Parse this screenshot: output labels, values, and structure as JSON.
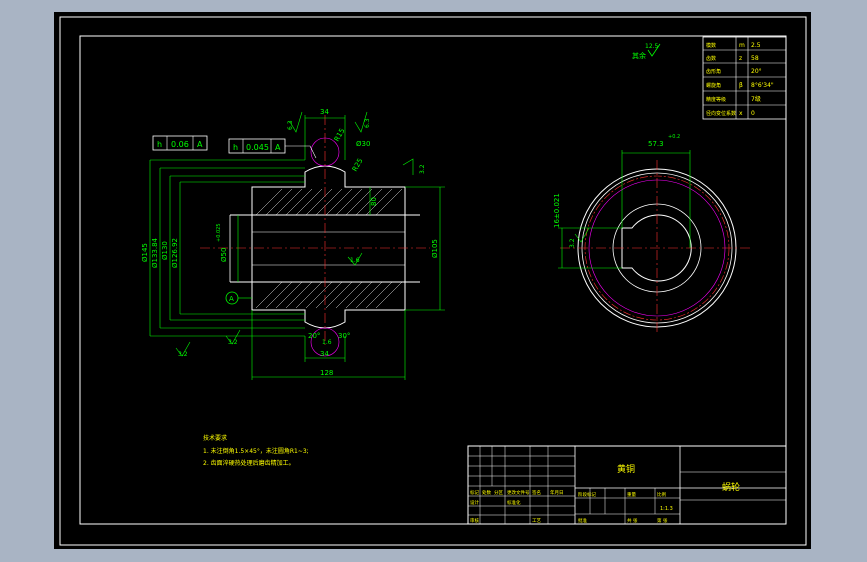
{
  "colors": {
    "background": "#000000",
    "frame": "#ffffff",
    "dimension": "#00ff00",
    "centerline": "#ff3030",
    "outline": "#ffffff",
    "note": "#ffff00",
    "gear_pitch": "#ff00ff"
  },
  "roughness": {
    "corner_label": "其余",
    "corner_value": "12.5",
    "r1": "6.3",
    "r2": "6.3",
    "r3": "3.2",
    "r4": "1.6",
    "r5": "3.2",
    "r6": "3.2",
    "r7": "1.6"
  },
  "tolerance_frames": {
    "f1": [
      "h",
      "0.06",
      "A"
    ],
    "f2": [
      "h",
      "0.045",
      "A"
    ]
  },
  "dims_left": {
    "top_width": "34",
    "bottom_width": "34",
    "overall_width": "128",
    "d1": "Ø145",
    "d2": "Ø133.84",
    "d3": "Ø130",
    "d4": "Ø126.92",
    "bore": "Ø50",
    "bore_tol": "+0.025",
    "hub": "Ø105",
    "groove": "Ø30",
    "dim_80": "80",
    "r25": "R25",
    "r15": "R15",
    "ang1": "20°",
    "ang2": "30°",
    "datum": "A"
  },
  "dims_right": {
    "top": "57.3",
    "top_tol": "+0.2",
    "keyway": "16±0.021",
    "rough": "3.2"
  },
  "params_table": [
    [
      "模数",
      "m",
      "2.5"
    ],
    [
      "齿数",
      "z",
      "58"
    ],
    [
      "齿形角",
      "",
      "20°"
    ],
    [
      "螺旋角",
      "β",
      "8°6'34\""
    ],
    [
      "精度等级",
      "",
      "7级"
    ],
    [
      "径向变位系数",
      "x",
      "0"
    ]
  ],
  "notes": {
    "title": "技术要求",
    "line1": "1. 未注倒角1.5×45°，未注圆角R1~3;",
    "line2": "2. 齿面淬硬热处理后磨齿精加工。"
  },
  "title_block": {
    "material": "黄铜",
    "part_name": "蜗轮",
    "scale": "1:1.3",
    "labels": [
      "标记",
      "处数",
      "分区",
      "更改文件号",
      "签名",
      "年月日",
      "设计",
      "标准化",
      "阶段标记",
      "重量",
      "比例",
      "审核",
      "工艺",
      "批准",
      "共 张",
      "第 张"
    ]
  }
}
